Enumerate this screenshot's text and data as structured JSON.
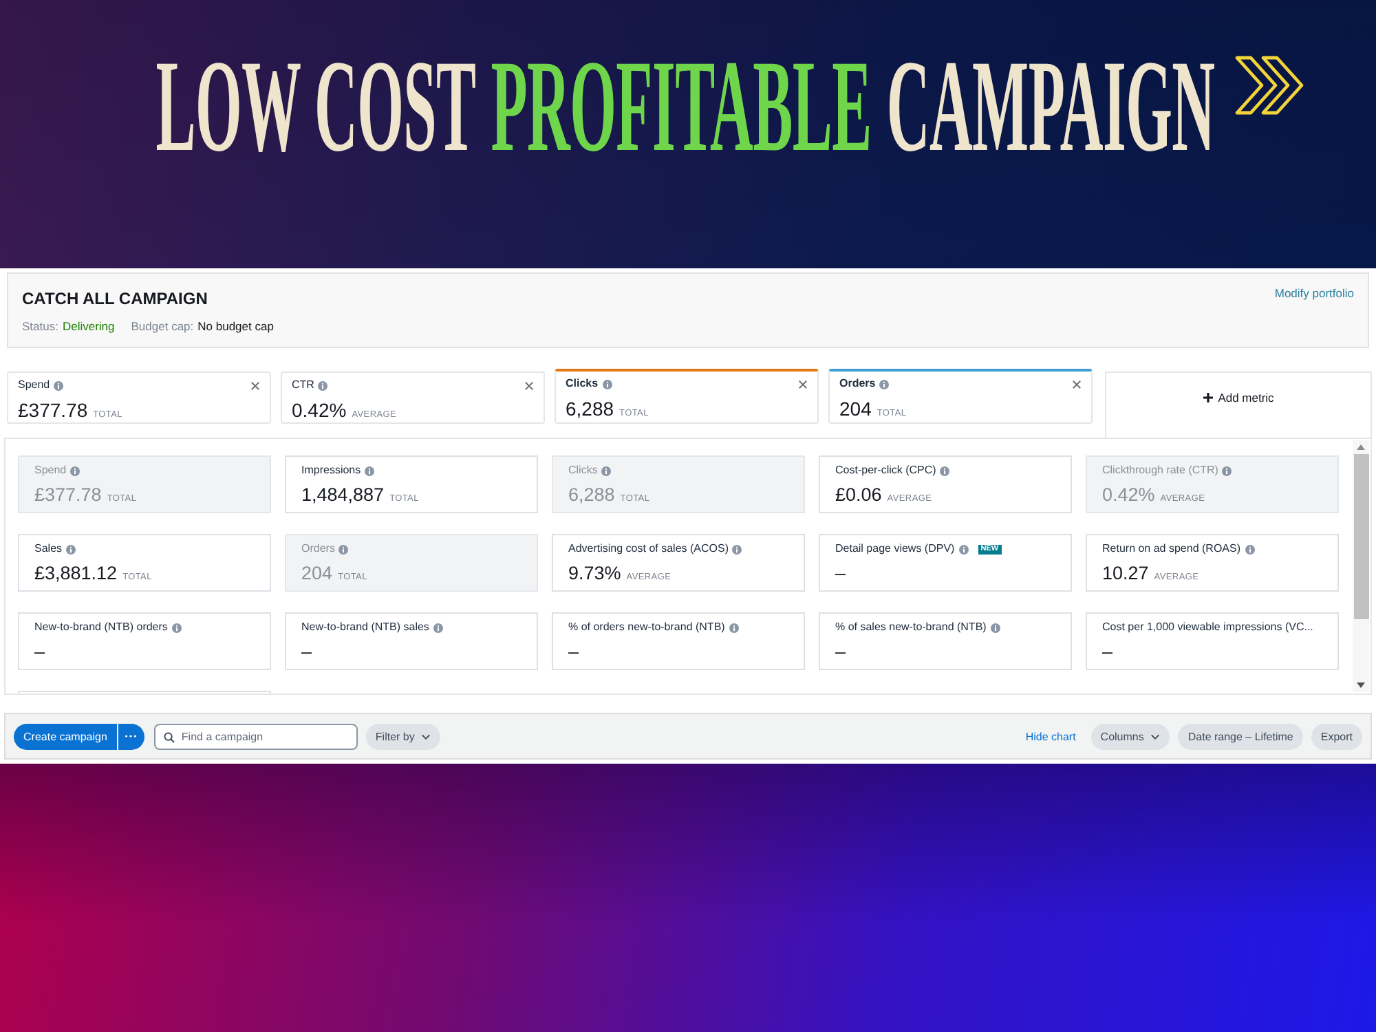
{
  "banner": {
    "headline": [
      {
        "text": "LOW COST",
        "highlight": false
      },
      {
        "text": "PROFITABLE",
        "highlight": true
      },
      {
        "text": "CAMPAIGN",
        "highlight": false
      }
    ]
  },
  "campaign": {
    "title": "CATCH ALL CAMPAIGN",
    "status_label": "Status:",
    "status": "Delivering",
    "budget_label": "Budget cap:",
    "budget": "No budget cap",
    "link": "Modify portfolio"
  },
  "metric_tabs": [
    {
      "label": "Spend",
      "info": true,
      "value": "£377.78",
      "unit": "TOTAL"
    },
    {
      "label": "CTR",
      "info": true,
      "value": "0.42%",
      "unit": "AVERAGE"
    },
    {
      "label": "Clicks",
      "info": true,
      "value": "6,288",
      "unit": "TOTAL",
      "color": "#e47911"
    },
    {
      "label": "Orders",
      "info": true,
      "value": "204",
      "unit": "TOTAL",
      "color": "#3f9ed6"
    }
  ],
  "add_metric": "Add metric",
  "metrics": [
    {
      "kind": "metric",
      "label": "Spend",
      "info": true,
      "value": "£377.78",
      "unit": "TOTAL",
      "selected": true
    },
    {
      "kind": "metric",
      "label": "Impressions",
      "info": true,
      "value": "1,484,887",
      "unit": "TOTAL",
      "selected": false
    },
    {
      "kind": "metric",
      "label": "Clicks",
      "info": true,
      "value": "6,288",
      "unit": "TOTAL",
      "selected": true
    },
    {
      "kind": "metric",
      "label": "Cost-per-click (CPC)",
      "info": true,
      "value": "£0.06",
      "unit": "AVERAGE",
      "selected": false
    },
    {
      "kind": "metric",
      "label": "Clickthrough rate (CTR)",
      "info": true,
      "value": "0.42%",
      "unit": "AVERAGE",
      "selected": true
    },
    {
      "kind": "metric",
      "label": "Sales",
      "info": true,
      "value": "£3,881.12",
      "unit": "TOTAL",
      "selected": false
    },
    {
      "kind": "metric",
      "label": "Orders",
      "info": true,
      "value": "204",
      "unit": "TOTAL",
      "selected": true
    },
    {
      "kind": "metric",
      "label": "Advertising cost of sales (ACOS)",
      "info": true,
      "value": "9.73%",
      "unit": "AVERAGE",
      "selected": false
    },
    {
      "kind": "metric",
      "label": "Detail page views (DPV)",
      "info": true,
      "badge": "NEW",
      "value": "–",
      "selected": false
    },
    {
      "kind": "metric",
      "label": "Return on ad spend (ROAS)",
      "info": true,
      "value": "10.27",
      "unit": "AVERAGE",
      "selected": false
    },
    {
      "kind": "metric",
      "label": "New-to-brand (NTB) orders",
      "info": true,
      "value": "–",
      "selected": false
    },
    {
      "kind": "metric",
      "label": "New-to-brand (NTB) sales",
      "info": true,
      "value": "–",
      "selected": false
    },
    {
      "kind": "metric",
      "label": "% of orders new-to-brand (NTB)",
      "info": true,
      "value": "–",
      "selected": false
    },
    {
      "kind": "metric",
      "label": "% of sales new-to-brand (NTB)",
      "info": true,
      "value": "–",
      "selected": false
    },
    {
      "kind": "metric",
      "label": "Cost per 1,000 viewable impressions (VC...",
      "info": false,
      "value": "–",
      "selected": false
    },
    {
      "kind": "partial"
    }
  ],
  "toolbar": {
    "create_button": "Create campaign",
    "search": {
      "placeholder": "Find a campaign"
    },
    "filter_button": "Filter by",
    "hide_chart_link": "Hide chart",
    "columns_button": "Columns",
    "date_range_button": "Date range – Lifetime",
    "export_button": "Export"
  }
}
